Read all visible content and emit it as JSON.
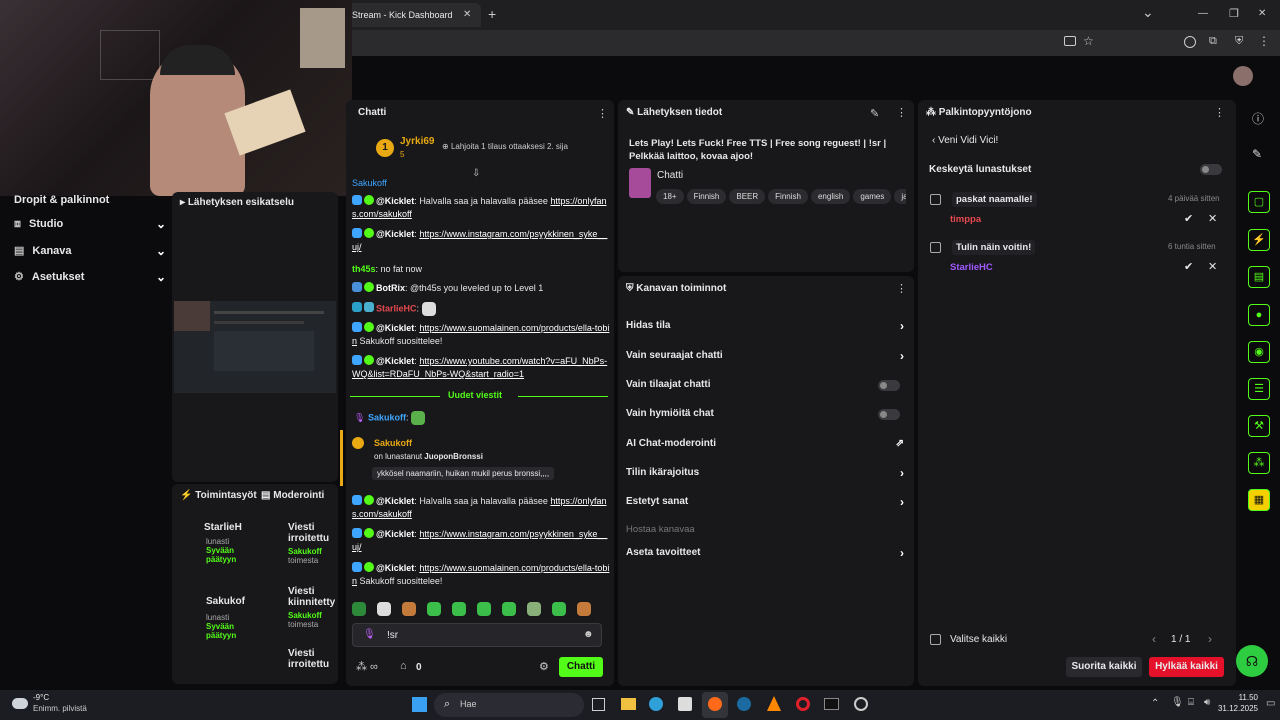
{
  "browser": {
    "tab_title": "Stream - Kick Dashboard",
    "tab_close": "✕",
    "new_tab": "+",
    "win_min": "—",
    "win_max": "❐",
    "win_close": "✕",
    "chevron": "⌄"
  },
  "sidebar": {
    "items": [
      {
        "label": "Dropit & palkinnot"
      },
      {
        "label": "Studio"
      },
      {
        "label": "Kanava"
      },
      {
        "label": "Asetukset"
      }
    ],
    "preview_title": "Lähetyksen esikatselu",
    "activity_tab": "Toimintasyöt",
    "moderation_tab": "Moderointi",
    "activity": [
      {
        "user": "StarlieH",
        "action": "lunasti",
        "reward": "Syvään päätyyn"
      },
      {
        "user": "Sakukof",
        "action": "lunasti",
        "reward": "Syvään päätyyn"
      }
    ],
    "moderation": [
      {
        "title": "Viesti irroitettu",
        "user": "Sakukoff",
        "action": "toimesta"
      },
      {
        "title": "Viesti kiinnitetty",
        "user": "Sakukoff",
        "action": "toimesta"
      },
      {
        "title": "Viesti irroitettu",
        "user": "",
        "action": ""
      }
    ]
  },
  "chat": {
    "title": "Chatti",
    "top_gifter": {
      "rank": "1",
      "name": "Jyrki69",
      "count": "5"
    },
    "gift_prompt": "Lahjoita 1 tilaus ottaaksesi 2. sija",
    "pinned_user": "Sakukoff",
    "messages": [
      {
        "user": "@Kicklet",
        "prefix": "Halvalla saa ja halavalla pääsee",
        "link": "https://onlyfans.com/sakukoff",
        "suffix": ""
      },
      {
        "user": "@Kicklet",
        "prefix": "",
        "link": "https://www.instagram.com/psyykkinen_syke__uj/",
        "suffix": ""
      },
      {
        "user": "th45s",
        "prefix": "no fat now",
        "link": "",
        "suffix": ""
      },
      {
        "user": "BotRix",
        "prefix": "@th45s you leveled up to Level 1",
        "link": "",
        "suffix": ""
      },
      {
        "user": "StarlieHC",
        "prefix": "",
        "link": "",
        "suffix": ""
      },
      {
        "user": "@Kicklet",
        "prefix": "",
        "link": "https://www.suomalainen.com/products/ella-tobin",
        "suffix": "Sakukoff suosittelee!"
      },
      {
        "user": "@Kicklet",
        "prefix": "",
        "link": "https://www.youtube.com/watch?v=aFU_NbPs-WQ&list=RDaFU_NbPs-WQ&start_radio=1",
        "suffix": ""
      }
    ],
    "new_messages": "Uudet viestit",
    "new_user": "Sakukoff",
    "redeem": {
      "user": "Sakukoff",
      "text": "on lunastanut",
      "reward": "JuoponBronssi",
      "message": "ykkösel naamariin, huikan mukil perus bronssi,,,,"
    },
    "messages2": [
      {
        "user": "@Kicklet",
        "prefix": "Halvalla saa ja halavalla pääsee",
        "link": "https://onlyfans.com/sakukoff",
        "suffix": ""
      },
      {
        "user": "@Kicklet",
        "prefix": "",
        "link": "https://www.instagram.com/psyykkinen_syke__uj/",
        "suffix": ""
      },
      {
        "user": "@Kicklet",
        "prefix": "",
        "link": "https://www.suomalainen.com/products/ella-tobin",
        "suffix": "Sakukoff suosittelee!"
      }
    ],
    "input_value": "!sr",
    "bottom_count": "0",
    "send_label": "Chatti"
  },
  "stream_info": {
    "title": "Lähetyksen tiedot",
    "stream_title": "Lets Play! Lets Fuck! Free TTS | Free song reguest! | !sr | Pelkkää laittoo, kovaa ajoo!",
    "category": "Chatti",
    "tags": [
      "18+",
      "Finnish",
      "BEER",
      "Finnish",
      "english",
      "games",
      "ja"
    ]
  },
  "channel_actions": {
    "title": "Kanavan toiminnot",
    "items": [
      {
        "label": "Hidas tila",
        "control": "chevron"
      },
      {
        "label": "Vain seuraajat chatti",
        "control": "chevron"
      },
      {
        "label": "Vain tilaajat chatti",
        "control": "toggle"
      },
      {
        "label": "Vain hymiöitä chat",
        "control": "toggle"
      },
      {
        "label": "AI Chat-moderointi",
        "control": "external"
      },
      {
        "label": "Tilin ikärajoitus",
        "control": "chevron"
      },
      {
        "label": "Estetyt sanat",
        "control": "chevron"
      },
      {
        "label": "Hostaa kanavaa",
        "control": "none"
      },
      {
        "label": "Aseta tavoitteet",
        "control": "chevron"
      }
    ]
  },
  "rewards": {
    "title": "Palkintopyyntöjono",
    "back_label": "Veni Vidi Vici!",
    "pause_label": "Keskeytä lunastukset",
    "requests": [
      {
        "message": "paskat naamalle!",
        "user": "timppa",
        "time": "4 päivää sitten",
        "user_color": "#e5484d"
      },
      {
        "message": "Tulin näin voitin!",
        "user": "StarlieHC",
        "time": "6 tuntia sitten",
        "user_color": "#a259ff"
      }
    ],
    "select_all": "Valitse kaikki",
    "pagination": "1 / 1",
    "approve_all": "Suorita kaikki",
    "reject_all": "Hylkää kaikki"
  },
  "taskbar": {
    "weather_temp": "-9°C",
    "weather_desc": "Enimm. pilvistä",
    "search_placeholder": "Hae",
    "time": "11.50",
    "date": "31.12.2025"
  },
  "colors": {
    "accent": "#53fc18",
    "danger": "#e5102a"
  }
}
